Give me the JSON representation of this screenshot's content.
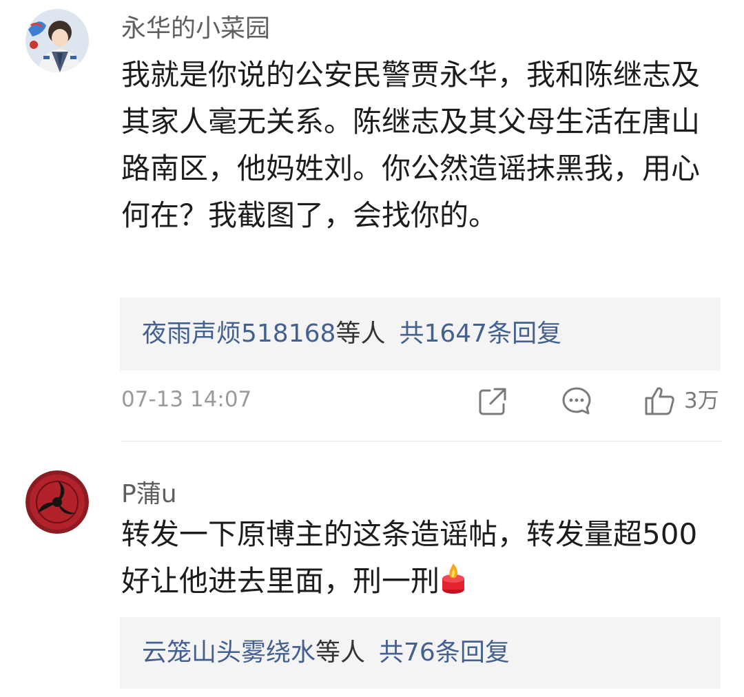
{
  "comments": [
    {
      "username": "永华的小菜园",
      "text": "我就是你说的公安民警贾永华，我和陈继志及其家人毫无关系。陈继志及其父母生活在唐山路南区，他妈姓刘。你公然造谣抹黑我，用心何在？我截图了，会找你的。",
      "reply_names": "夜雨声烦518168",
      "reply_etc": "等人",
      "reply_total": "共1647条回复",
      "timestamp": "07-13 14:07",
      "like_count": "3万"
    },
    {
      "username": "P蒲u",
      "text": "转发一下原博主的这条造谣帖，转发量超500好让他进去里面，刑一刑",
      "emoji": "fire-emoji",
      "reply_names": "云笼山头雾绕水",
      "reply_etc": "等人",
      "reply_total": "共76条回复"
    }
  ],
  "icons": {
    "share": "share-icon",
    "comment": "comment-icon",
    "like": "thumbs-up-icon"
  },
  "colors": {
    "link": "#43608f",
    "reply_bg": "#f4f4f4",
    "meta": "#9a9a9a"
  }
}
